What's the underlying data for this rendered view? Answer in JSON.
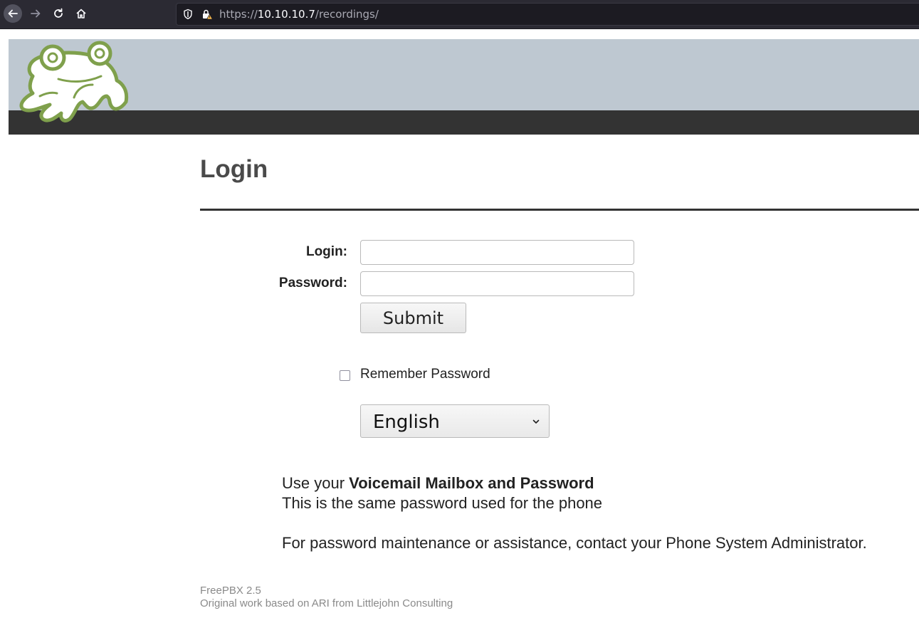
{
  "browser": {
    "url_scheme": "https://",
    "url_host": "10.10.10.7",
    "url_path": "/recordings/"
  },
  "login": {
    "title": "Login",
    "login_label": "Login:",
    "password_label": "Password:",
    "login_value": "",
    "password_value": "",
    "submit_label": "Submit",
    "remember_label": "Remember Password",
    "remember_checked": false,
    "language_selected": "English"
  },
  "info": {
    "line1_prefix": "Use your ",
    "line1_bold": "Voicemail Mailbox and Password",
    "line2": "This is the same password used for the phone",
    "line3": "For password maintenance or assistance, contact your Phone System Administrator."
  },
  "footer": {
    "version": "FreePBX 2.5",
    "credit": "Original work based on ARI from Littlejohn Consulting"
  },
  "colors": {
    "header_light": "#bec8d1",
    "header_dark": "#333333",
    "logo_green": "#7fa04c"
  },
  "icons": [
    "back-arrow-icon",
    "forward-arrow-icon",
    "reload-icon",
    "home-icon",
    "shield-icon",
    "insecure-lock-icon",
    "chevron-down-icon",
    "frog-logo"
  ]
}
